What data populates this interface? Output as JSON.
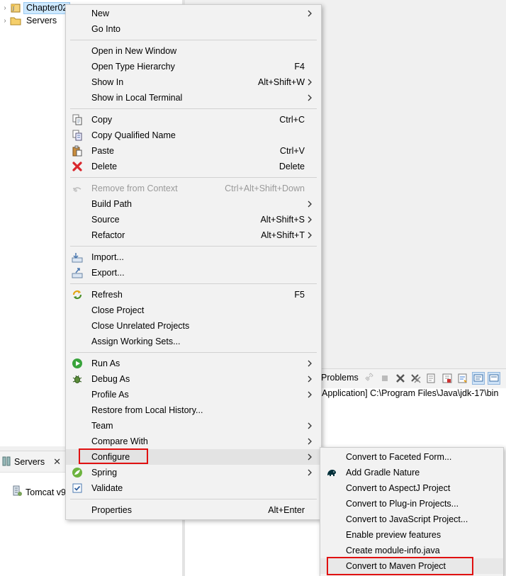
{
  "explorer": {
    "items": [
      {
        "label": "Chapter02",
        "icon": "project-icon",
        "selected": true
      },
      {
        "label": "Servers",
        "icon": "folder-icon",
        "selected": false
      }
    ]
  },
  "console": {
    "tab_label": "Problems",
    "line": "Application] C:\\Program Files\\Java\\jdk-17\\bin"
  },
  "servers_view": {
    "tab_label": "Servers",
    "close_glyph": "✕",
    "item_label": "Tomcat v9"
  },
  "context_menu": {
    "items": [
      {
        "label": "New",
        "accel": "",
        "submenu": true,
        "icon": ""
      },
      {
        "label": "Go Into",
        "accel": "",
        "submenu": false,
        "icon": ""
      },
      {
        "label": "Open in New Window",
        "accel": "",
        "submenu": false,
        "icon": ""
      },
      {
        "label": "Open Type Hierarchy",
        "accel": "F4",
        "submenu": false,
        "icon": ""
      },
      {
        "label": "Show In",
        "accel": "Alt+Shift+W",
        "submenu": true,
        "icon": ""
      },
      {
        "label": "Show in Local Terminal",
        "accel": "",
        "submenu": true,
        "icon": ""
      },
      {
        "label": "Copy",
        "accel": "Ctrl+C",
        "submenu": false,
        "icon": "copy-icon"
      },
      {
        "label": "Copy Qualified Name",
        "accel": "",
        "submenu": false,
        "icon": "copy-qualified-name-icon"
      },
      {
        "label": "Paste",
        "accel": "Ctrl+V",
        "submenu": false,
        "icon": "paste-icon"
      },
      {
        "label": "Delete",
        "accel": "Delete",
        "submenu": false,
        "icon": "delete-icon"
      },
      {
        "label": "Remove from Context",
        "accel": "Ctrl+Alt+Shift+Down",
        "submenu": false,
        "icon": "remove-context-icon",
        "disabled": true
      },
      {
        "label": "Build Path",
        "accel": "",
        "submenu": true,
        "icon": ""
      },
      {
        "label": "Source",
        "accel": "Alt+Shift+S",
        "submenu": true,
        "icon": ""
      },
      {
        "label": "Refactor",
        "accel": "Alt+Shift+T",
        "submenu": true,
        "icon": ""
      },
      {
        "label": "Import...",
        "accel": "",
        "submenu": false,
        "icon": "import-icon"
      },
      {
        "label": "Export...",
        "accel": "",
        "submenu": false,
        "icon": "export-icon"
      },
      {
        "label": "Refresh",
        "accel": "F5",
        "submenu": false,
        "icon": "refresh-icon"
      },
      {
        "label": "Close Project",
        "accel": "",
        "submenu": false,
        "icon": ""
      },
      {
        "label": "Close Unrelated Projects",
        "accel": "",
        "submenu": false,
        "icon": ""
      },
      {
        "label": "Assign Working Sets...",
        "accel": "",
        "submenu": false,
        "icon": ""
      },
      {
        "label": "Run As",
        "accel": "",
        "submenu": true,
        "icon": "run-icon"
      },
      {
        "label": "Debug As",
        "accel": "",
        "submenu": true,
        "icon": "debug-icon"
      },
      {
        "label": "Profile As",
        "accel": "",
        "submenu": true,
        "icon": ""
      },
      {
        "label": "Restore from Local History...",
        "accel": "",
        "submenu": false,
        "icon": ""
      },
      {
        "label": "Team",
        "accel": "",
        "submenu": true,
        "icon": ""
      },
      {
        "label": "Compare With",
        "accel": "",
        "submenu": true,
        "icon": ""
      },
      {
        "label": "Configure",
        "accel": "",
        "submenu": true,
        "icon": "",
        "highlighted": true
      },
      {
        "label": "Spring",
        "accel": "",
        "submenu": true,
        "icon": "spring-icon"
      },
      {
        "label": "Validate",
        "accel": "",
        "submenu": false,
        "icon": "validate-check-icon"
      },
      {
        "label": "Properties",
        "accel": "Alt+Enter",
        "submenu": false,
        "icon": ""
      }
    ]
  },
  "configure_submenu": {
    "items": [
      {
        "label": "Convert to Faceted Form...",
        "icon": ""
      },
      {
        "label": "Add Gradle Nature",
        "icon": "gradle-elephant-icon"
      },
      {
        "label": "Convert to AspectJ Project",
        "icon": ""
      },
      {
        "label": "Convert to Plug-in Projects...",
        "icon": ""
      },
      {
        "label": "Convert to JavaScript Project...",
        "icon": ""
      },
      {
        "label": "Enable preview features",
        "icon": ""
      },
      {
        "label": "Create module-info.java",
        "icon": ""
      },
      {
        "label": "Convert to Maven Project",
        "icon": "",
        "highlighted": true
      }
    ]
  },
  "annotation_color": "#e01010"
}
